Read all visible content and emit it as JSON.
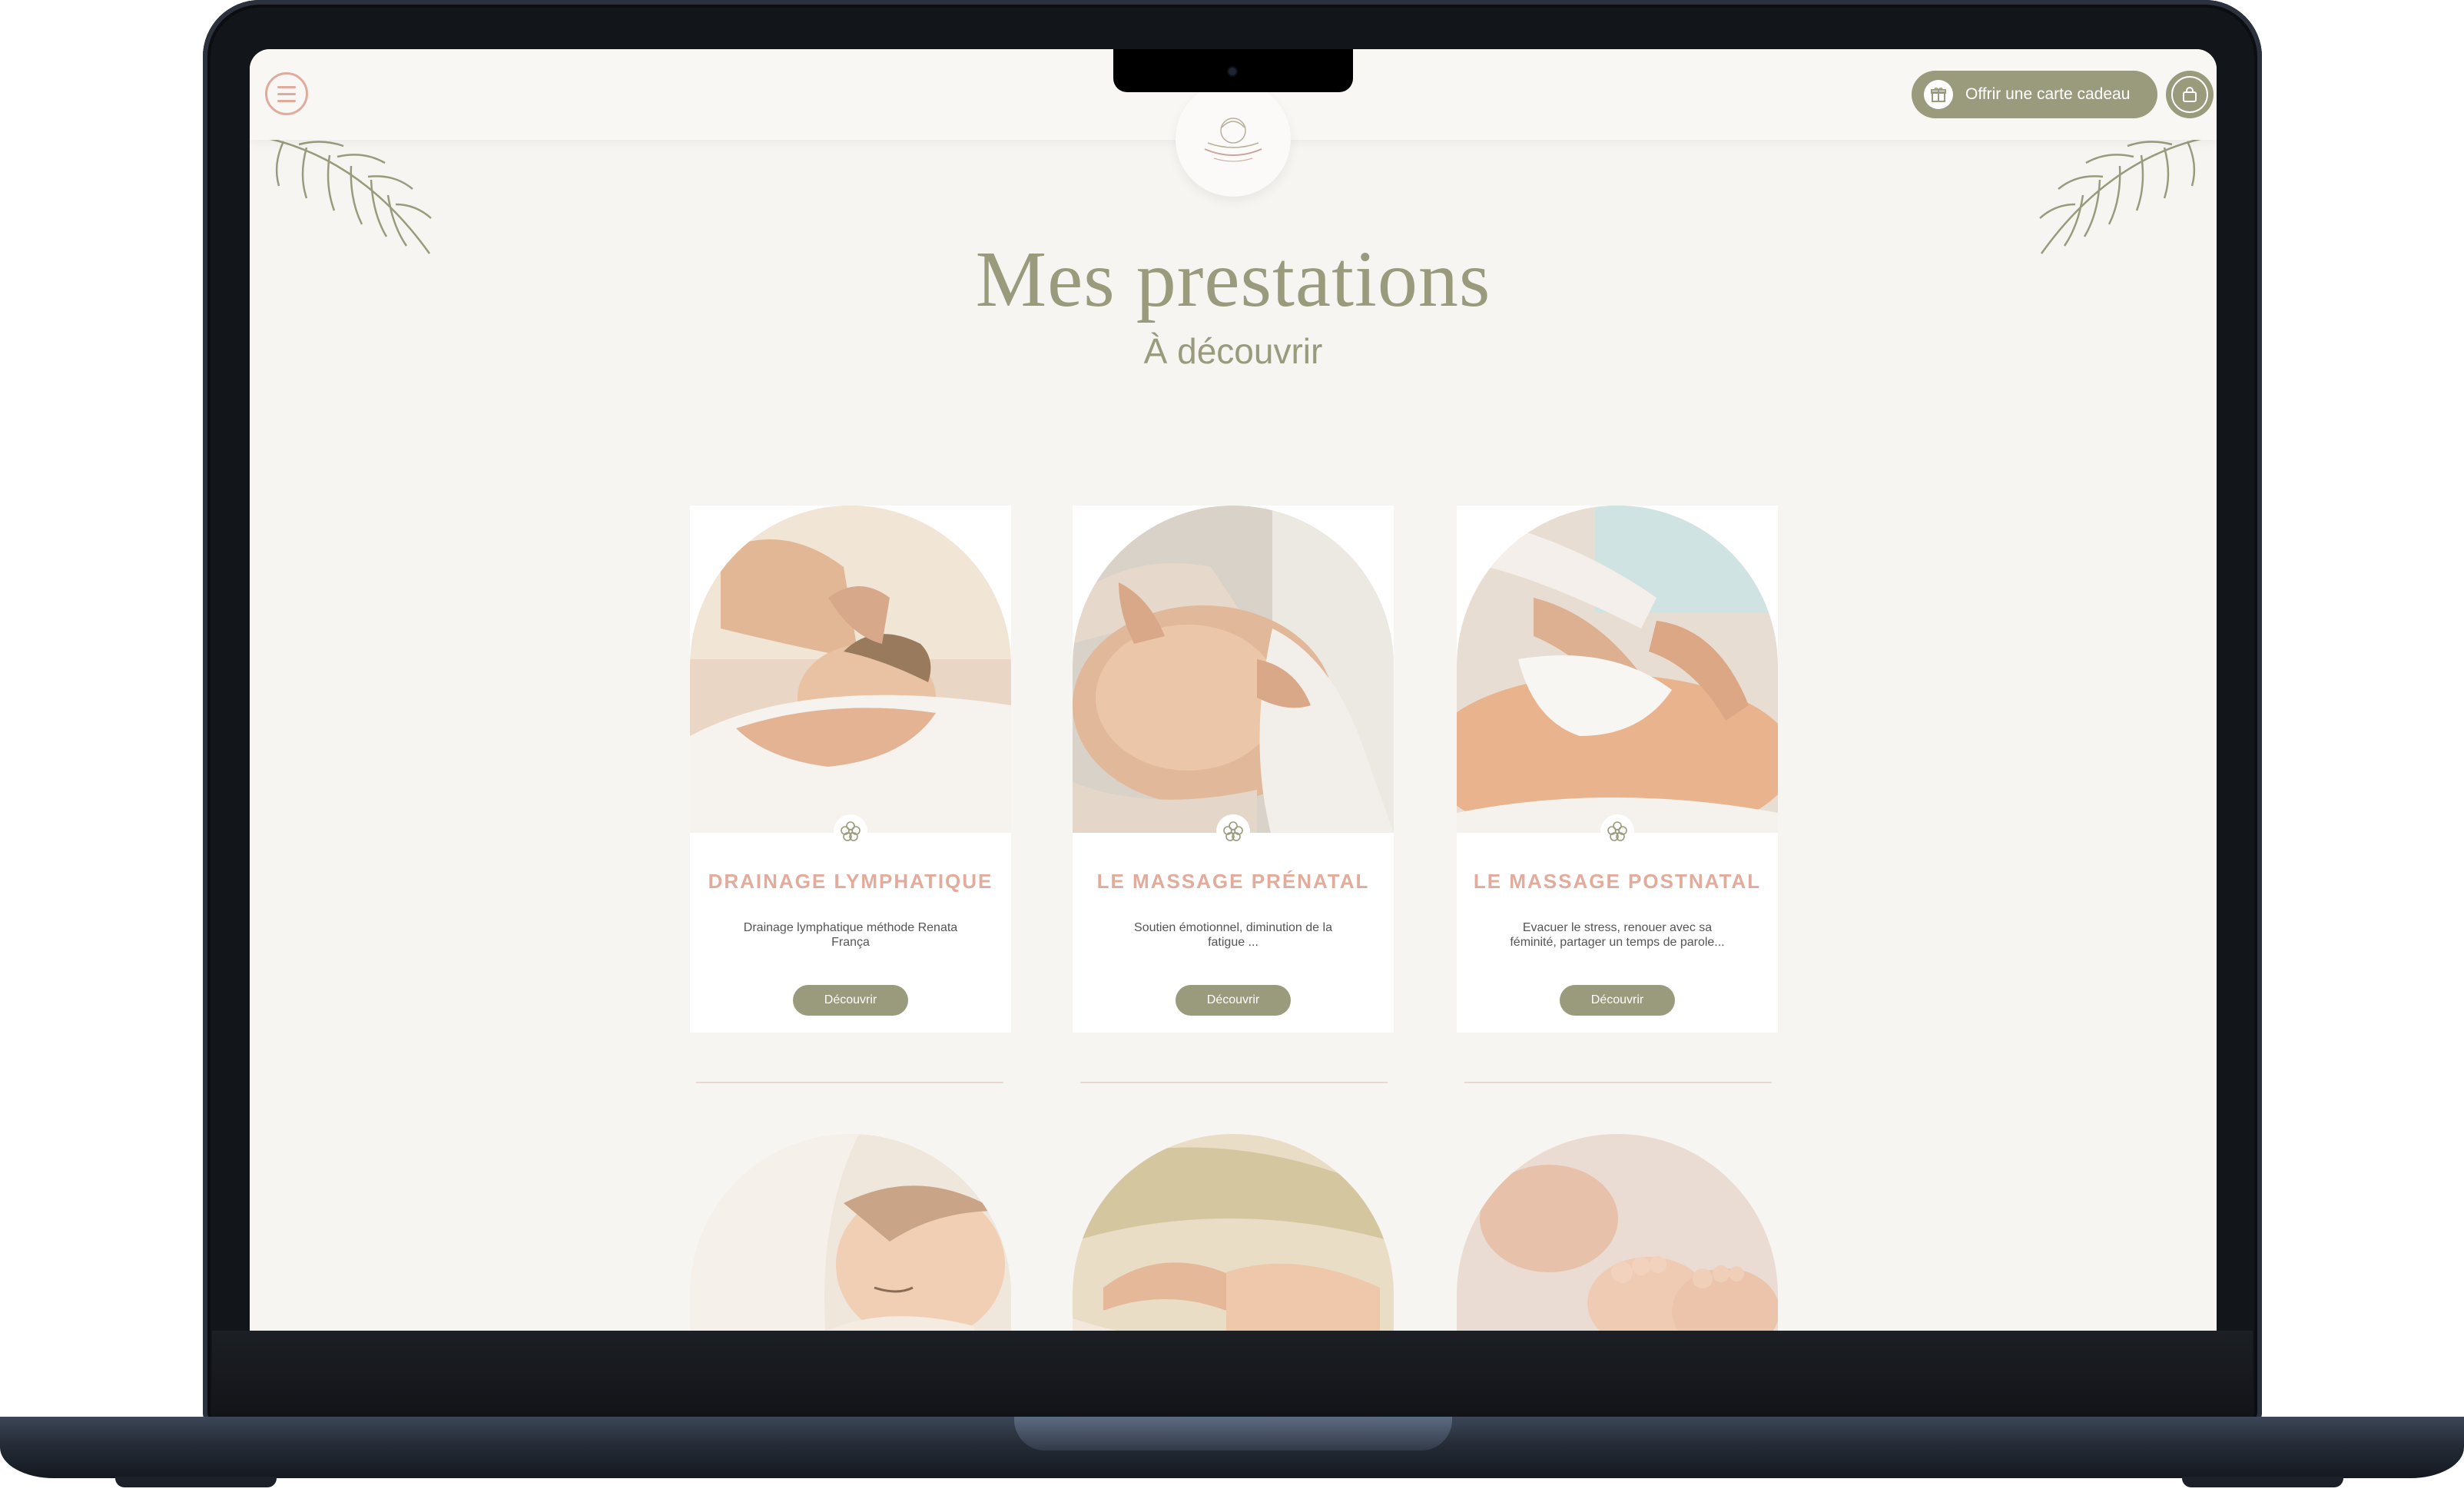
{
  "header": {
    "gift_label": "Offrir une carte cadeau"
  },
  "page": {
    "title": "Mes prestations",
    "subtitle": "À découvrir"
  },
  "services": [
    {
      "title": "DRAINAGE LYMPHATIQUE",
      "description": "Drainage lymphatique méthode Renata França",
      "button": "Découvrir"
    },
    {
      "title": "LE MASSAGE PRÉNATAL",
      "description": "Soutien émotionnel, diminution de la fatigue ...",
      "button": "Découvrir"
    },
    {
      "title": "LE MASSAGE POSTNATAL",
      "description": "Evacuer le stress, renouer avec sa féminité, partager un temps de parole...",
      "button": "Découvrir"
    }
  ],
  "colors": {
    "accent_olive": "#9a9a7c",
    "accent_pink": "#e2ab9c",
    "background": "#f7f5f2"
  }
}
